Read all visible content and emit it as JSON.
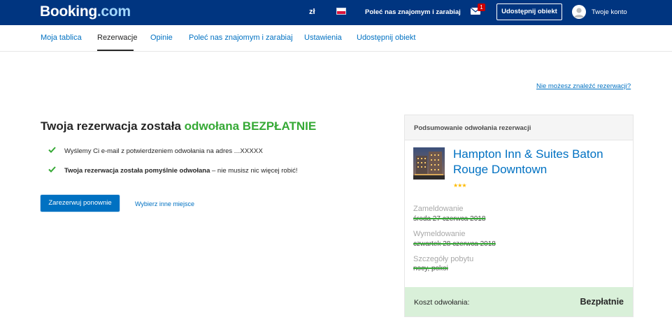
{
  "header": {
    "logo_main": "Booking",
    "logo_suffix": ".com",
    "currency": "zł",
    "refer_label": "Poleć nas znajomym i zarabiaj",
    "mail_count": "1",
    "list_property_label": "Udostępnij obiekt",
    "account_label": "Twoje konto"
  },
  "nav": {
    "tabs": [
      {
        "label": "Moja tablica",
        "active": false
      },
      {
        "label": "Rezerwacje",
        "active": true
      },
      {
        "label": "Opinie",
        "active": false
      },
      {
        "label": "Poleć nas znajomym i zarabiaj",
        "active": false
      },
      {
        "label": "Ustawienia",
        "active": false
      },
      {
        "label": "Udostępnij obiekt",
        "active": false
      }
    ]
  },
  "main": {
    "cant_find_link": "Nie możesz znaleźć rezerwacji?",
    "title_prefix": "Twoja rezerwacja została ",
    "title_highlight": "odwołana BEZPŁATNIE",
    "email_msg": "Wyślemy Ci e-mail z potwierdzeniem odwołania na adres ",
    "email_masked": "...XXXXX",
    "success_bold": "Twoja rezerwacja została pomyślnie odwołana",
    "success_rest": " – nie musisz nic więcej robić!",
    "rebook_button": "Zarezerwuj ponownie",
    "other_place_link": "Wybierz inne miejsce"
  },
  "summary": {
    "title": "Podsumowanie odwołania rezerwacji",
    "hotel_name": "Hampton Inn & Suites Baton Rouge Downtown",
    "stars": "★★★",
    "checkin_label": "Zameldowanie",
    "checkin_value": "środa 27 czerwca 2018",
    "checkout_label": "Wymeldowanie",
    "checkout_value": "czwartek 28 czerwca 2018",
    "details_label": "Szczegóły pobytu",
    "details_value": "nocy, pokoi",
    "fee_label": "Koszt odwołania:",
    "fee_value": "Bezpłatnie"
  },
  "colors": {
    "brand_blue": "#003580",
    "link_blue": "#0071c2",
    "success_green": "#35a935",
    "fee_bg": "#d9f0d9",
    "star_yellow": "#febb02"
  }
}
